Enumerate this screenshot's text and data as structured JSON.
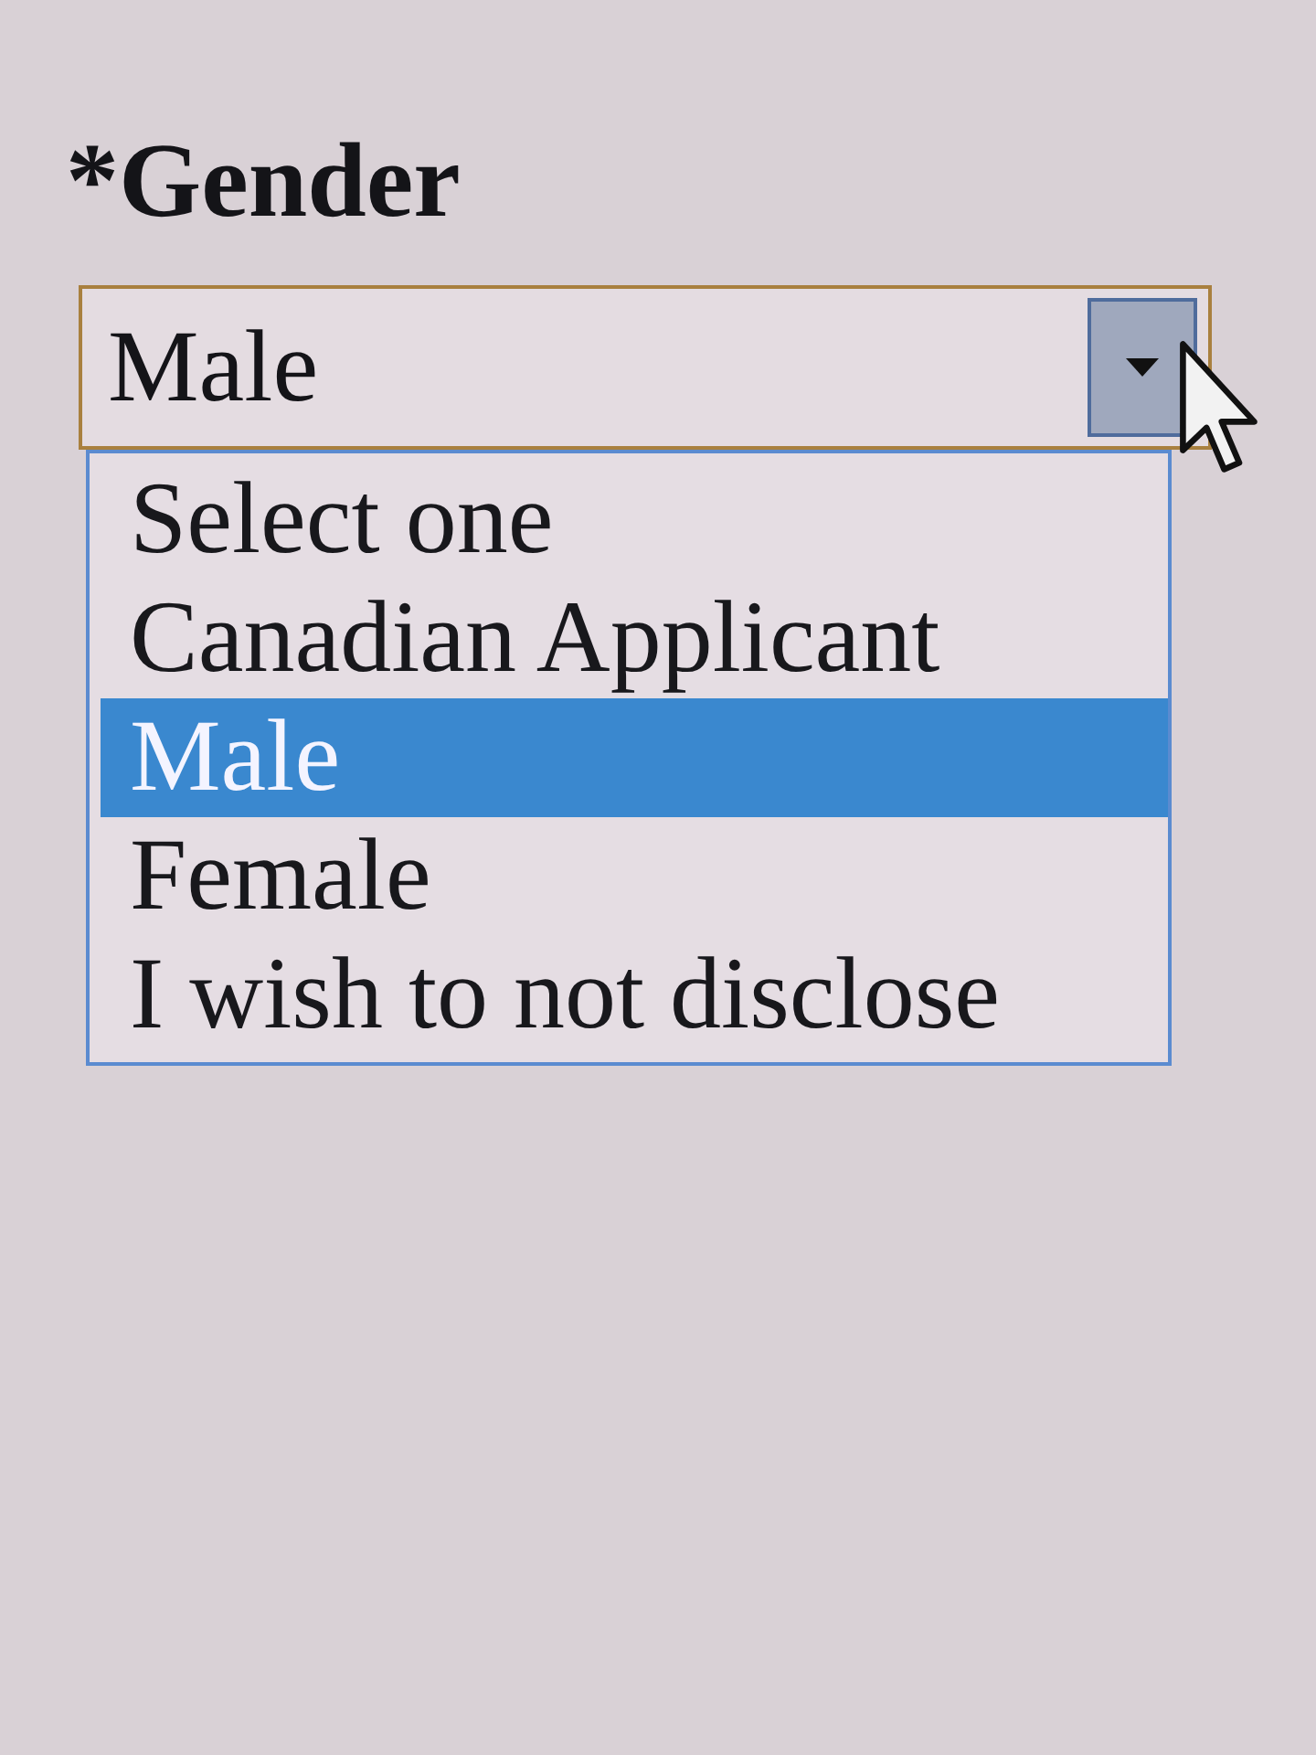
{
  "gender": {
    "label": "*Gender",
    "value": "Male",
    "expanded": true,
    "options": [
      {
        "label": "Select one",
        "selected": false
      },
      {
        "label": "Canadian Applicant",
        "selected": false
      },
      {
        "label": "Male",
        "selected": true
      },
      {
        "label": "Female",
        "selected": false
      },
      {
        "label": "I wish to not disclose",
        "selected": false
      }
    ]
  }
}
